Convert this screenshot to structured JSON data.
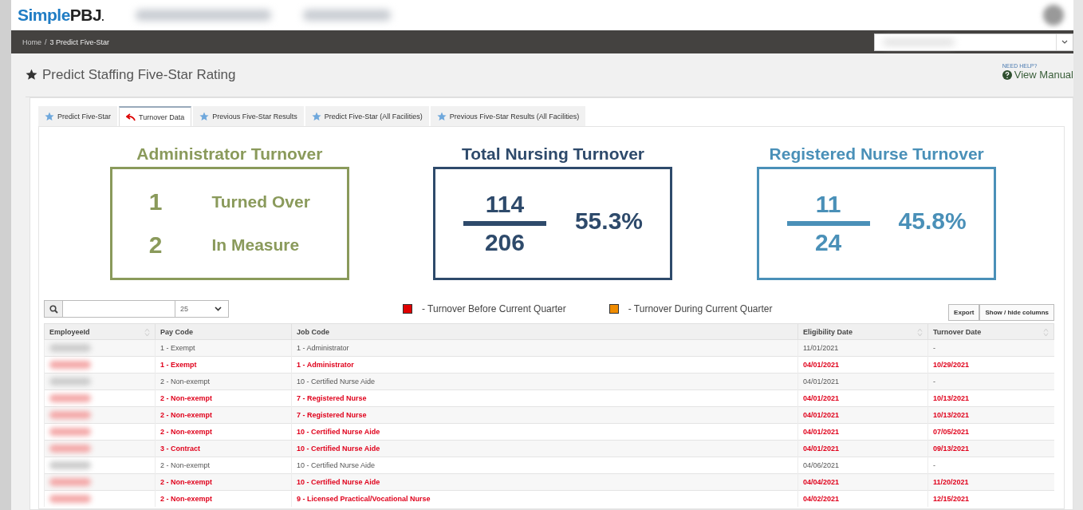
{
  "app": {
    "logo_part_1": "Simple",
    "logo_part_2": "PBJ",
    "logo_mark": "."
  },
  "breadcrumb": [
    {
      "label": "Home"
    },
    {
      "label": "3 Predict Five-Star"
    }
  ],
  "breadcrumb_separator": "/",
  "page_title": "Predict Staffing Five-Star Rating",
  "help": {
    "caption": "NEED HELP?",
    "link": "View Manual"
  },
  "tabs": [
    {
      "label": "Predict Five-Star",
      "selected": false
    },
    {
      "label": "Turnover Data",
      "selected": true
    },
    {
      "label": "Previous Five-Star Results",
      "selected": false
    },
    {
      "label": "Predict Five-Star (All Facilities)",
      "selected": false
    },
    {
      "label": "Previous Five-Star Results (All Facilities)",
      "selected": false
    }
  ],
  "cards": [
    {
      "kind": "counts",
      "title": "Administrator Turnover",
      "color": "#8a9a5b",
      "items": [
        {
          "value": "1",
          "label": "Turned Over"
        },
        {
          "value": "2",
          "label": "In Measure"
        }
      ]
    },
    {
      "kind": "fraction",
      "title": "Total Nursing Turnover",
      "color": "#2e4a6b",
      "numerator": "114",
      "denominator": "206",
      "percent": "55.3%"
    },
    {
      "kind": "fraction",
      "title": "Registered Nurse Turnover",
      "color": "#4a90b8",
      "numerator": "11",
      "denominator": "24",
      "percent": "45.8%"
    }
  ],
  "table_tools": {
    "page_size": "25",
    "legend": [
      {
        "color": "#e00000",
        "label": "- Turnover Before Current Quarter"
      },
      {
        "color": "#f08c00",
        "label": "- Turnover During Current Quarter"
      }
    ],
    "buttons": [
      "Export",
      "Show / hide columns"
    ]
  },
  "table": {
    "columns": [
      {
        "label": "EmployeeId",
        "sortable": true
      },
      {
        "label": "Pay Code",
        "sortable": false
      },
      {
        "label": "Job Code",
        "sortable": false
      },
      {
        "label": "Eligibility Date",
        "sortable": true
      },
      {
        "label": "Turnover Date",
        "sortable": true
      }
    ],
    "rows": [
      {
        "turnover_before_quarter": false,
        "cells": [
          "",
          "1 - Exempt",
          "1 - Administrator",
          "11/01/2021",
          "-"
        ]
      },
      {
        "turnover_before_quarter": true,
        "cells": [
          "",
          "1 - Exempt",
          "1 - Administrator",
          "04/01/2021",
          "10/29/2021"
        ]
      },
      {
        "turnover_before_quarter": false,
        "cells": [
          "",
          "2 - Non-exempt",
          "10 - Certified Nurse Aide",
          "04/01/2021",
          "-"
        ]
      },
      {
        "turnover_before_quarter": true,
        "cells": [
          "",
          "2 - Non-exempt",
          "7 - Registered Nurse",
          "04/01/2021",
          "10/13/2021"
        ]
      },
      {
        "turnover_before_quarter": true,
        "cells": [
          "",
          "2 - Non-exempt",
          "7 - Registered Nurse",
          "04/01/2021",
          "10/13/2021"
        ]
      },
      {
        "turnover_before_quarter": true,
        "cells": [
          "",
          "2 - Non-exempt",
          "10 - Certified Nurse Aide",
          "04/01/2021",
          "07/05/2021"
        ]
      },
      {
        "turnover_before_quarter": true,
        "cells": [
          "",
          "3 - Contract",
          "10 - Certified Nurse Aide",
          "04/01/2021",
          "09/13/2021"
        ]
      },
      {
        "turnover_before_quarter": false,
        "cells": [
          "",
          "2 - Non-exempt",
          "10 - Certified Nurse Aide",
          "04/06/2021",
          "-"
        ]
      },
      {
        "turnover_before_quarter": true,
        "cells": [
          "",
          "2 - Non-exempt",
          "10 - Certified Nurse Aide",
          "04/04/2021",
          "11/20/2021"
        ]
      },
      {
        "turnover_before_quarter": true,
        "cells": [
          "",
          "2 - Non-exempt",
          "9 - Licensed Practical/Vocational Nurse",
          "04/02/2021",
          "12/15/2021"
        ]
      }
    ]
  }
}
